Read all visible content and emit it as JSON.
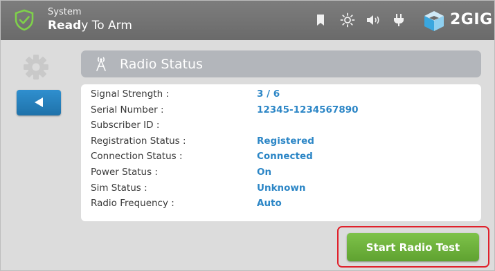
{
  "status_bar": {
    "system_label": "System",
    "status_bold": "Read",
    "status_rest": "y To Arm",
    "brand_text": "2GIG",
    "icons": [
      "bookmark-icon",
      "brightness-icon",
      "volume-icon",
      "power-plug-icon",
      "2gig-logo-icon"
    ]
  },
  "sidebar": {
    "gear_icon": "gear-icon",
    "back_icon": "back-arrow-icon"
  },
  "panel": {
    "title": "Radio Status",
    "title_icon": "radio-tower-icon"
  },
  "radio_status": {
    "rows": [
      {
        "label": "Signal Strength :",
        "value": "3 / 6"
      },
      {
        "label": "Serial Number :",
        "value": "12345-1234567890"
      },
      {
        "label": "Subscriber ID :",
        "value": ""
      },
      {
        "label": "Registration Status :",
        "value": "Registered"
      },
      {
        "label": "Connection Status :",
        "value": "Connected"
      },
      {
        "label": "Power Status :",
        "value": "On"
      },
      {
        "label": "Sim Status :",
        "value": "Unknown"
      },
      {
        "label": "Radio Frequency :",
        "value": "Auto"
      }
    ]
  },
  "actions": {
    "start_radio_test": "Start Radio Test"
  },
  "colors": {
    "topbar": "#737373",
    "value_blue": "#2c86c6",
    "button_green": "#6cb23a",
    "back_blue": "#2a86c4",
    "highlight_red": "#e0212b"
  }
}
